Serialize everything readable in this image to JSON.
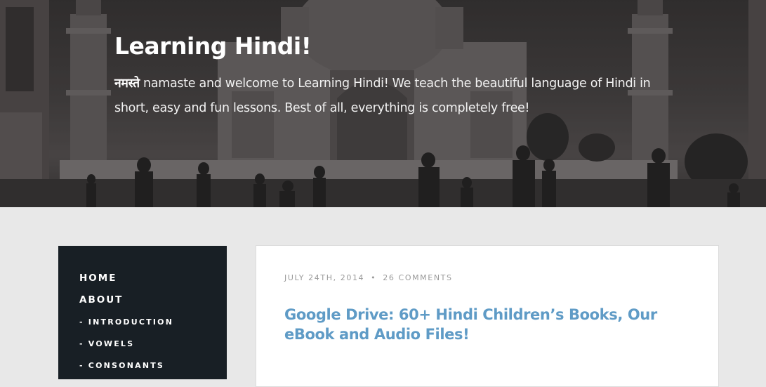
{
  "hero": {
    "title": "Learning Hindi!",
    "intro_hindi": "नमस्ते",
    "intro_text": " namaste and welcome to Learning Hindi! We teach the beautiful language of Hindi in short, easy and fun lessons. Best of all, everything is completely free!"
  },
  "nav": {
    "items": [
      {
        "label": "HOME"
      },
      {
        "label": "ABOUT"
      },
      {
        "label": "- INTRODUCTION"
      },
      {
        "label": "- VOWELS"
      },
      {
        "label": "- CONSONANTS"
      }
    ]
  },
  "post": {
    "date": "JULY 24TH, 2014",
    "separator": "•",
    "comments": "26 COMMENTS",
    "title": "Google Drive: 60+ Hindi Children’s Books, Our eBook and Audio Files!"
  },
  "colors": {
    "link_blue": "#5f9bc6",
    "sidebar_bg": "#181f25",
    "page_bg": "#e8e8e8"
  }
}
